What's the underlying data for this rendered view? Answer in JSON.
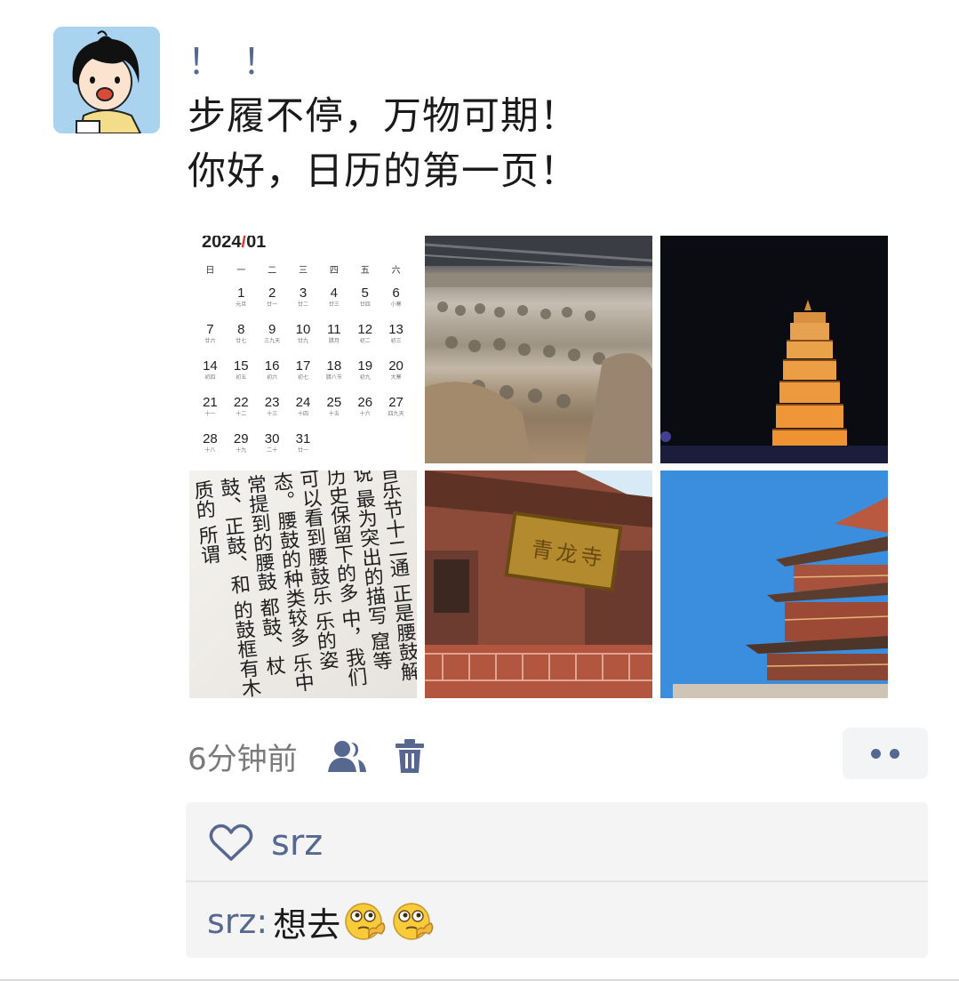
{
  "post": {
    "exclamation": "！！",
    "line1": "步履不停，万物可期！",
    "line2": "你好，日历的第一页！"
  },
  "calendar": {
    "year": "2024",
    "slash": "/",
    "month": "01",
    "weekdays": [
      "日",
      "一",
      "二",
      "三",
      "四",
      "五",
      "六"
    ],
    "days": [
      {
        "n": "",
        "l": ""
      },
      {
        "n": "1",
        "l": "元旦"
      },
      {
        "n": "2",
        "l": "廿一"
      },
      {
        "n": "3",
        "l": "廿二"
      },
      {
        "n": "4",
        "l": "廿三"
      },
      {
        "n": "5",
        "l": "廿四"
      },
      {
        "n": "6",
        "l": "小寒"
      },
      {
        "n": "7",
        "l": "廿六"
      },
      {
        "n": "8",
        "l": "廿七"
      },
      {
        "n": "9",
        "l": "三九天"
      },
      {
        "n": "10",
        "l": "廿九"
      },
      {
        "n": "11",
        "l": "腊月"
      },
      {
        "n": "12",
        "l": "初二"
      },
      {
        "n": "13",
        "l": "初三"
      },
      {
        "n": "14",
        "l": "初四"
      },
      {
        "n": "15",
        "l": "初五"
      },
      {
        "n": "16",
        "l": "初六"
      },
      {
        "n": "17",
        "l": "初七"
      },
      {
        "n": "18",
        "l": "腊八节"
      },
      {
        "n": "19",
        "l": "初九"
      },
      {
        "n": "20",
        "l": "大寒"
      },
      {
        "n": "21",
        "l": "十一"
      },
      {
        "n": "22",
        "l": "十二"
      },
      {
        "n": "23",
        "l": "十三"
      },
      {
        "n": "24",
        "l": "十四"
      },
      {
        "n": "25",
        "l": "十五"
      },
      {
        "n": "26",
        "l": "十六"
      },
      {
        "n": "27",
        "l": "四九天"
      },
      {
        "n": "28",
        "l": "十八"
      },
      {
        "n": "29",
        "l": "十九"
      },
      {
        "n": "30",
        "l": "二十"
      },
      {
        "n": "31",
        "l": "廿一"
      }
    ]
  },
  "calligraphy_text": "音乐节十二通 正是腰鼓解说 最为突出的描写 窟等历史保留下的多 中，我们可以看到腰鼓乐 乐的姿态。腰鼓的种类较多 乐中常提到的腰鼓 都鼓、杖鼓、正鼓、和 的鼓框有木质的 所谓",
  "signboard_text": "青龙寺",
  "meta": {
    "time": "6分钟前"
  },
  "likes": {
    "users": "srz"
  },
  "comments": [
    {
      "user": "srz",
      "colon": ":",
      "text": "想去"
    }
  ],
  "colors": {
    "link": "#56688f",
    "muted": "#7a7a7a",
    "panel": "#f4f4f5"
  },
  "icons": {
    "visibility": "person-group-icon",
    "delete": "trash-icon",
    "more": "more-dots-icon",
    "like": "heart-outline-icon"
  }
}
